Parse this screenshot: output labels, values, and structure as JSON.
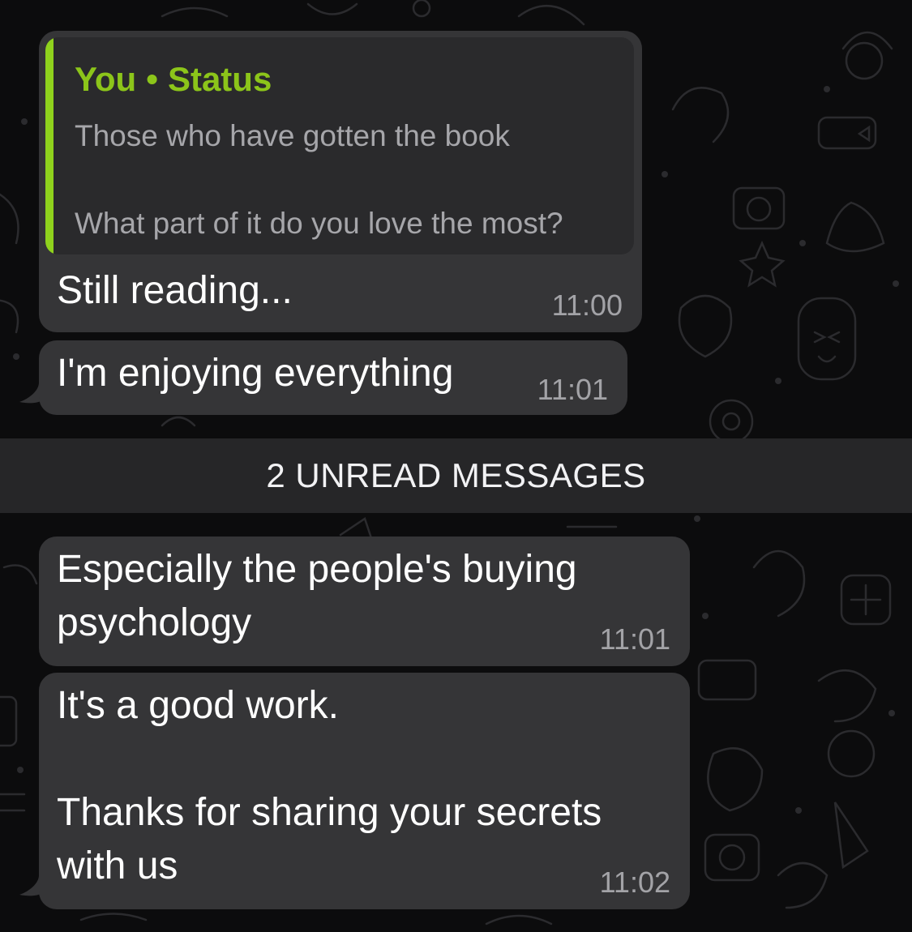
{
  "quoted_status": {
    "author": "You",
    "label": "Status",
    "text": "Those who have gotten the book\n\nWhat part of it do you love the most?"
  },
  "messages": [
    {
      "text": "Still reading...",
      "time": "11:00"
    },
    {
      "text": "I'm enjoying everything",
      "time": "11:01"
    },
    {
      "text": "Especially the people's buying\npsychology",
      "time": "11:01"
    },
    {
      "text": "It's a good work.\n\nThanks for sharing your secrets\nwith us",
      "time": "11:02"
    }
  ],
  "unread_banner": "2 UNREAD MESSAGES",
  "colors": {
    "bubble": "#353537",
    "quote_accent": "#8fd21d",
    "quote_author": "#8cc51a",
    "background": "#0c0c0d"
  }
}
